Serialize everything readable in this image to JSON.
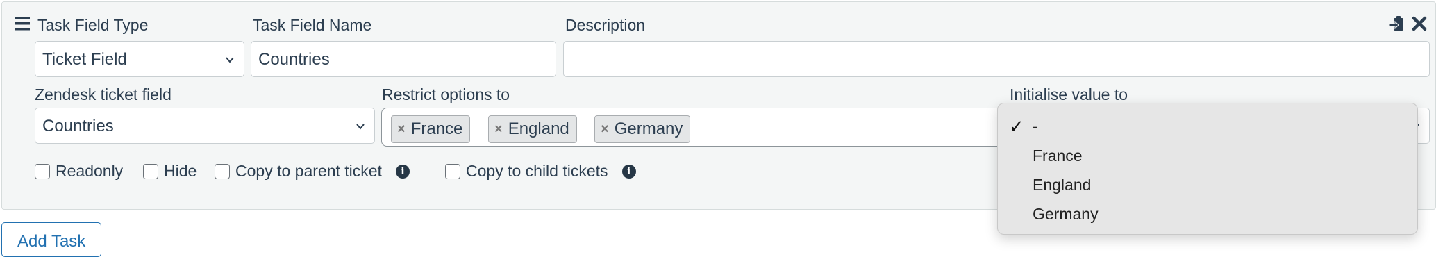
{
  "task": {
    "field_type": {
      "label": "Task Field Type",
      "value": "Ticket Field"
    },
    "field_name": {
      "label": "Task Field Name",
      "value": "Countries"
    },
    "description": {
      "label": "Description",
      "value": ""
    },
    "zendesk_field": {
      "label": "Zendesk ticket field",
      "value": "Countries"
    },
    "restrict": {
      "label": "Restrict options to",
      "tags": [
        "France",
        "England",
        "Germany"
      ]
    },
    "initialise": {
      "label": "Initialise value to"
    },
    "checkboxes": {
      "readonly": "Readonly",
      "hide": "Hide",
      "copy_parent": "Copy to parent ticket",
      "copy_child": "Copy to child tickets"
    }
  },
  "dropdown": {
    "selected_mark": "✓",
    "options": [
      "-",
      "France",
      "England",
      "Germany"
    ]
  },
  "buttons": {
    "add_task": "Add Task"
  },
  "icons": {
    "drag": "hamburger-icon",
    "clipboard": "clipboard-icon",
    "close": "close-icon",
    "info": "info-icon"
  },
  "colors": {
    "panel_bg": "#f4f6f6",
    "text": "#2c3e50",
    "accent": "#2271b1"
  }
}
